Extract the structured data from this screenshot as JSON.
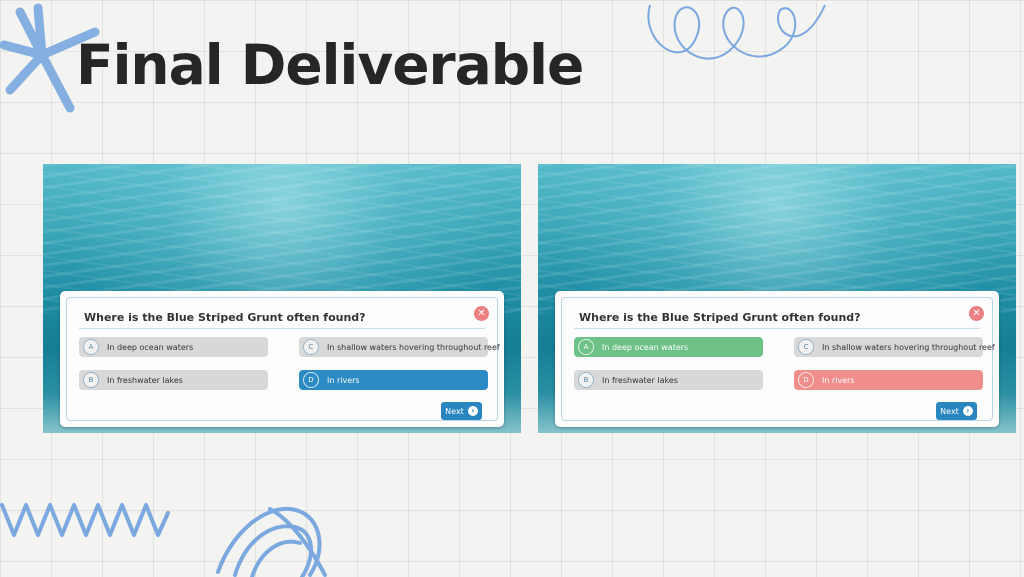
{
  "slide": {
    "title": "Final Deliverable"
  },
  "quiz_before": {
    "question": "Where is the Blue Striped Grunt often found?",
    "close_icon": "close-icon",
    "options": [
      {
        "letter": "A",
        "label": "In deep ocean waters",
        "state": "default"
      },
      {
        "letter": "C",
        "label": "In shallow waters hovering throughout reef",
        "state": "default"
      },
      {
        "letter": "B",
        "label": "In freshwater lakes",
        "state": "default"
      },
      {
        "letter": "D",
        "label": "In rivers",
        "state": "selected"
      }
    ],
    "next_label": "Next"
  },
  "quiz_after": {
    "question": "Where is the Blue Striped Grunt often found?",
    "close_icon": "close-icon",
    "options": [
      {
        "letter": "A",
        "label": "In deep ocean waters",
        "state": "correct"
      },
      {
        "letter": "C",
        "label": "In shallow waters hovering throughout reef",
        "state": "default"
      },
      {
        "letter": "B",
        "label": "In freshwater lakes",
        "state": "default"
      },
      {
        "letter": "D",
        "label": "In rivers",
        "state": "incorrect"
      }
    ],
    "next_label": "Next"
  },
  "colors": {
    "selected": "#2c8ac4",
    "correct": "#6ec187",
    "incorrect": "#f08e8c",
    "close": "#ec7f81",
    "next_button": "#2a86c0",
    "doodle": "#7aa8df"
  }
}
